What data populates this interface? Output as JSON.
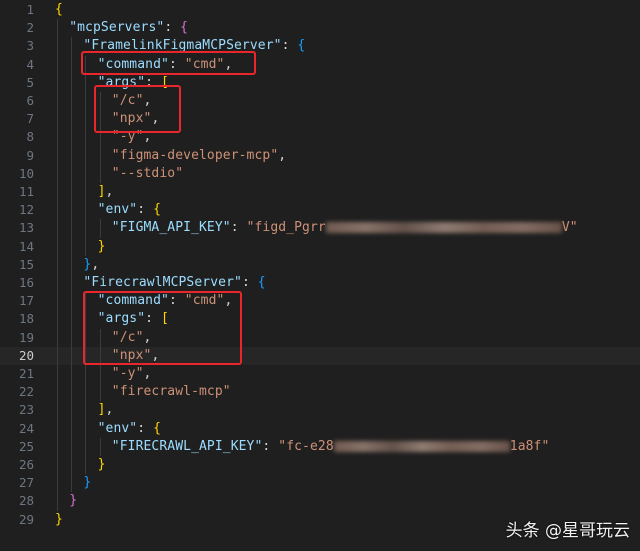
{
  "colors": {
    "background": "#1f1f1f",
    "current_line": "#262626",
    "line_number": "#6e7681",
    "key": "#9cdcfe",
    "string": "#ce9178",
    "bracket_level_1": "#ffd700",
    "bracket_level_2": "#da70d6",
    "bracket_level_3": "#179fff",
    "highlight_box": "#e8262b"
  },
  "editor": {
    "current_line": 20,
    "lines": [
      {
        "n": "1",
        "indent": 0,
        "tokens": [
          {
            "t": "{",
            "c": "b1"
          }
        ]
      },
      {
        "n": "2",
        "indent": 1,
        "tokens": [
          {
            "t": "\"mcpServers\"",
            "c": "key"
          },
          {
            "t": ": ",
            "c": "pun"
          },
          {
            "t": "{",
            "c": "b2"
          }
        ]
      },
      {
        "n": "3",
        "indent": 2,
        "tokens": [
          {
            "t": "\"FramelinkFigmaMCPServer\"",
            "c": "key"
          },
          {
            "t": ": ",
            "c": "pun"
          },
          {
            "t": "{",
            "c": "b3"
          }
        ]
      },
      {
        "n": "4",
        "indent": 3,
        "tokens": [
          {
            "t": "\"command\"",
            "c": "key"
          },
          {
            "t": ": ",
            "c": "pun"
          },
          {
            "t": "\"cmd\"",
            "c": "str"
          },
          {
            "t": ",",
            "c": "pun"
          }
        ]
      },
      {
        "n": "5",
        "indent": 3,
        "tokens": [
          {
            "t": "\"args\"",
            "c": "key"
          },
          {
            "t": ": ",
            "c": "pun"
          },
          {
            "t": "[",
            "c": "b1"
          }
        ]
      },
      {
        "n": "6",
        "indent": 4,
        "tokens": [
          {
            "t": "\"/c\"",
            "c": "str"
          },
          {
            "t": ",",
            "c": "pun"
          }
        ]
      },
      {
        "n": "7",
        "indent": 4,
        "tokens": [
          {
            "t": "\"npx\"",
            "c": "str"
          },
          {
            "t": ",",
            "c": "pun"
          }
        ]
      },
      {
        "n": "8",
        "indent": 4,
        "tokens": [
          {
            "t": "\"-y\"",
            "c": "str"
          },
          {
            "t": ",",
            "c": "pun"
          }
        ]
      },
      {
        "n": "9",
        "indent": 4,
        "tokens": [
          {
            "t": "\"figma-developer-mcp\"",
            "c": "str"
          },
          {
            "t": ",",
            "c": "pun"
          }
        ]
      },
      {
        "n": "10",
        "indent": 4,
        "tokens": [
          {
            "t": "\"--stdio\"",
            "c": "str"
          }
        ]
      },
      {
        "n": "11",
        "indent": 3,
        "tokens": [
          {
            "t": "]",
            "c": "b1"
          },
          {
            "t": ",",
            "c": "pun"
          }
        ]
      },
      {
        "n": "12",
        "indent": 3,
        "tokens": [
          {
            "t": "\"env\"",
            "c": "key"
          },
          {
            "t": ": ",
            "c": "pun"
          },
          {
            "t": "{",
            "c": "b1"
          }
        ]
      },
      {
        "n": "13",
        "indent": 4,
        "tokens": [
          {
            "t": "\"FIGMA_API_KEY\"",
            "c": "key"
          },
          {
            "t": ": ",
            "c": "pun"
          },
          {
            "t": "\"figd_Pgrr",
            "c": "str"
          },
          {
            "blur": true,
            "w": 236
          },
          {
            "t": "V\"",
            "c": "str"
          }
        ]
      },
      {
        "n": "14",
        "indent": 3,
        "tokens": [
          {
            "t": "}",
            "c": "b1"
          }
        ]
      },
      {
        "n": "15",
        "indent": 2,
        "tokens": [
          {
            "t": "}",
            "c": "b3"
          },
          {
            "t": ",",
            "c": "pun"
          }
        ]
      },
      {
        "n": "16",
        "indent": 2,
        "tokens": [
          {
            "t": "\"FirecrawlMCPServer\"",
            "c": "key"
          },
          {
            "t": ": ",
            "c": "pun"
          },
          {
            "t": "{",
            "c": "b3"
          }
        ]
      },
      {
        "n": "17",
        "indent": 3,
        "tokens": [
          {
            "t": "\"command\"",
            "c": "key"
          },
          {
            "t": ": ",
            "c": "pun"
          },
          {
            "t": "\"cmd\"",
            "c": "str"
          },
          {
            "t": ",",
            "c": "pun"
          }
        ]
      },
      {
        "n": "18",
        "indent": 3,
        "tokens": [
          {
            "t": "\"args\"",
            "c": "key"
          },
          {
            "t": ": ",
            "c": "pun"
          },
          {
            "t": "[",
            "c": "b1"
          }
        ]
      },
      {
        "n": "19",
        "indent": 4,
        "tokens": [
          {
            "t": "\"/c\"",
            "c": "str"
          },
          {
            "t": ",",
            "c": "pun"
          }
        ]
      },
      {
        "n": "20",
        "indent": 4,
        "tokens": [
          {
            "t": "\"npx\"",
            "c": "str"
          },
          {
            "t": ",",
            "c": "pun"
          }
        ]
      },
      {
        "n": "21",
        "indent": 4,
        "tokens": [
          {
            "t": "\"-y\"",
            "c": "str"
          },
          {
            "t": ",",
            "c": "pun"
          }
        ]
      },
      {
        "n": "22",
        "indent": 4,
        "tokens": [
          {
            "t": "\"firecrawl-mcp\"",
            "c": "str"
          }
        ]
      },
      {
        "n": "23",
        "indent": 3,
        "tokens": [
          {
            "t": "]",
            "c": "b1"
          },
          {
            "t": ",",
            "c": "pun"
          }
        ]
      },
      {
        "n": "24",
        "indent": 3,
        "tokens": [
          {
            "t": "\"env\"",
            "c": "key"
          },
          {
            "t": ": ",
            "c": "pun"
          },
          {
            "t": "{",
            "c": "b1"
          }
        ]
      },
      {
        "n": "25",
        "indent": 4,
        "tokens": [
          {
            "t": "\"FIRECRAWL_API_KEY\"",
            "c": "key"
          },
          {
            "t": ": ",
            "c": "pun"
          },
          {
            "t": "\"fc-e28",
            "c": "str"
          },
          {
            "blur": true,
            "w": 176
          },
          {
            "t": "1a8f\"",
            "c": "str"
          }
        ]
      },
      {
        "n": "26",
        "indent": 3,
        "tokens": [
          {
            "t": "}",
            "c": "b1"
          }
        ]
      },
      {
        "n": "27",
        "indent": 2,
        "tokens": [
          {
            "t": "}",
            "c": "b3"
          }
        ]
      },
      {
        "n": "28",
        "indent": 1,
        "tokens": [
          {
            "t": "}",
            "c": "b2"
          }
        ]
      },
      {
        "n": "29",
        "indent": 0,
        "tokens": [
          {
            "t": "}",
            "c": "b1"
          }
        ]
      }
    ]
  },
  "watermark": {
    "text": "头条 @星哥玩云"
  }
}
